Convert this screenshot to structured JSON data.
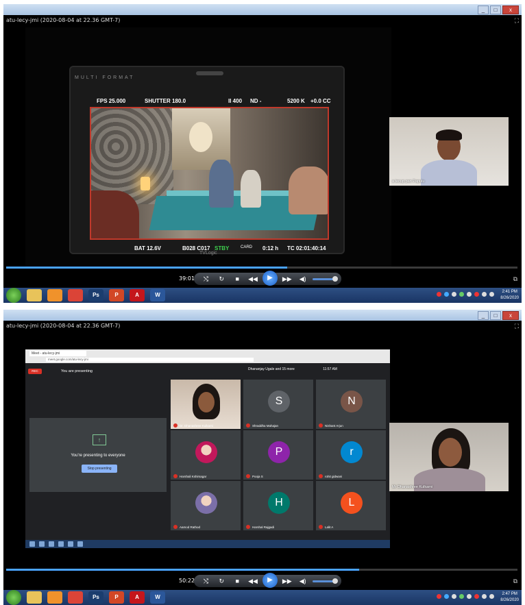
{
  "panel1": {
    "file_title": "atu-lecy-jmi (2020-08-04 at 22.36 GMT-7)",
    "monitor": {
      "brand": "MULTI FORMAT",
      "fps": "FPS 25.000",
      "shutter": "SHUTTER 180.0",
      "iso": "II 400",
      "nd": "ND -",
      "wb": "5200 K",
      "tint": "+0.0 CC",
      "battery": "BAT 12.6V",
      "clip": "B028 C017",
      "status": "STBY",
      "card": "CARD",
      "remaining": "0:12 h",
      "timecode": "TC 02:01:40:14",
      "logo": "TVLogic"
    },
    "webcam_label": "a tecup pan Papulu",
    "player": {
      "time": "39:01",
      "progress": 0.55
    },
    "clock": {
      "time": "2:41 PM",
      "date": "8/26/2020"
    }
  },
  "panel2": {
    "file_title": "atu-lecy-jmi (2020-08-04 at 22.36 GMT-7)",
    "meet": {
      "tab_title": "Meet - atu-lecy-jmi",
      "url": "meet.google.com/atu-lecy-jmi",
      "rec_label": "REC",
      "presenting_bar": "You are presenting",
      "presenting_msg": "You're presenting to everyone",
      "stop_label": "Stop presenting",
      "top_right_name": "Dhananjay Ugale and 15 more",
      "top_right_time": "11:57 AM",
      "tiles": [
        {
          "kind": "photo",
          "name": "Dr. Dhanashree Kulkarni",
          "color": "#8b5a3c"
        },
        {
          "kind": "letter",
          "letter": "S",
          "name": "Shraddha Mahajan",
          "color": "#5f6368"
        },
        {
          "kind": "letter",
          "letter": "N",
          "name": "Nishant Arjun",
          "color": "#795548"
        },
        {
          "kind": "avatar",
          "name": "Harshali Kshirsagar",
          "color": "#c2185b"
        },
        {
          "kind": "letter",
          "letter": "P",
          "name": "Pooja S",
          "color": "#8e24aa"
        },
        {
          "kind": "letter",
          "letter": "r",
          "name": "rohit gidwani",
          "color": "#0288d1"
        },
        {
          "kind": "avatar",
          "name": "Aamod Rathod",
          "color": "#7b6fa8"
        },
        {
          "kind": "letter",
          "letter": "H",
          "name": "Harshal Rajgadi",
          "color": "#00796b"
        },
        {
          "kind": "letter",
          "letter": "L",
          "name": "Lalit A",
          "color": "#f4511e"
        }
      ]
    },
    "webcam_label": "Mr Dhanashree Kulkarni",
    "player": {
      "time": "50:22",
      "progress": 0.69
    },
    "clock": {
      "time": "2:47 PM",
      "date": "8/26/2020"
    }
  },
  "taskbar": {
    "apps": [
      {
        "icon": "explorer-icon",
        "label": "",
        "color": "#e8c35a"
      },
      {
        "icon": "media-player-icon",
        "label": "",
        "color": "#f0922b"
      },
      {
        "icon": "chrome-icon",
        "label": "",
        "color": "#db4437"
      },
      {
        "icon": "photoshop-icon",
        "label": "Ps",
        "color": "#1b3d6e"
      },
      {
        "icon": "powerpoint-icon",
        "label": "P",
        "color": "#d24726"
      },
      {
        "icon": "acrobat-icon",
        "label": "A",
        "color": "#c4161c"
      },
      {
        "icon": "word-icon",
        "label": "W",
        "color": "#2b579a"
      }
    ]
  }
}
